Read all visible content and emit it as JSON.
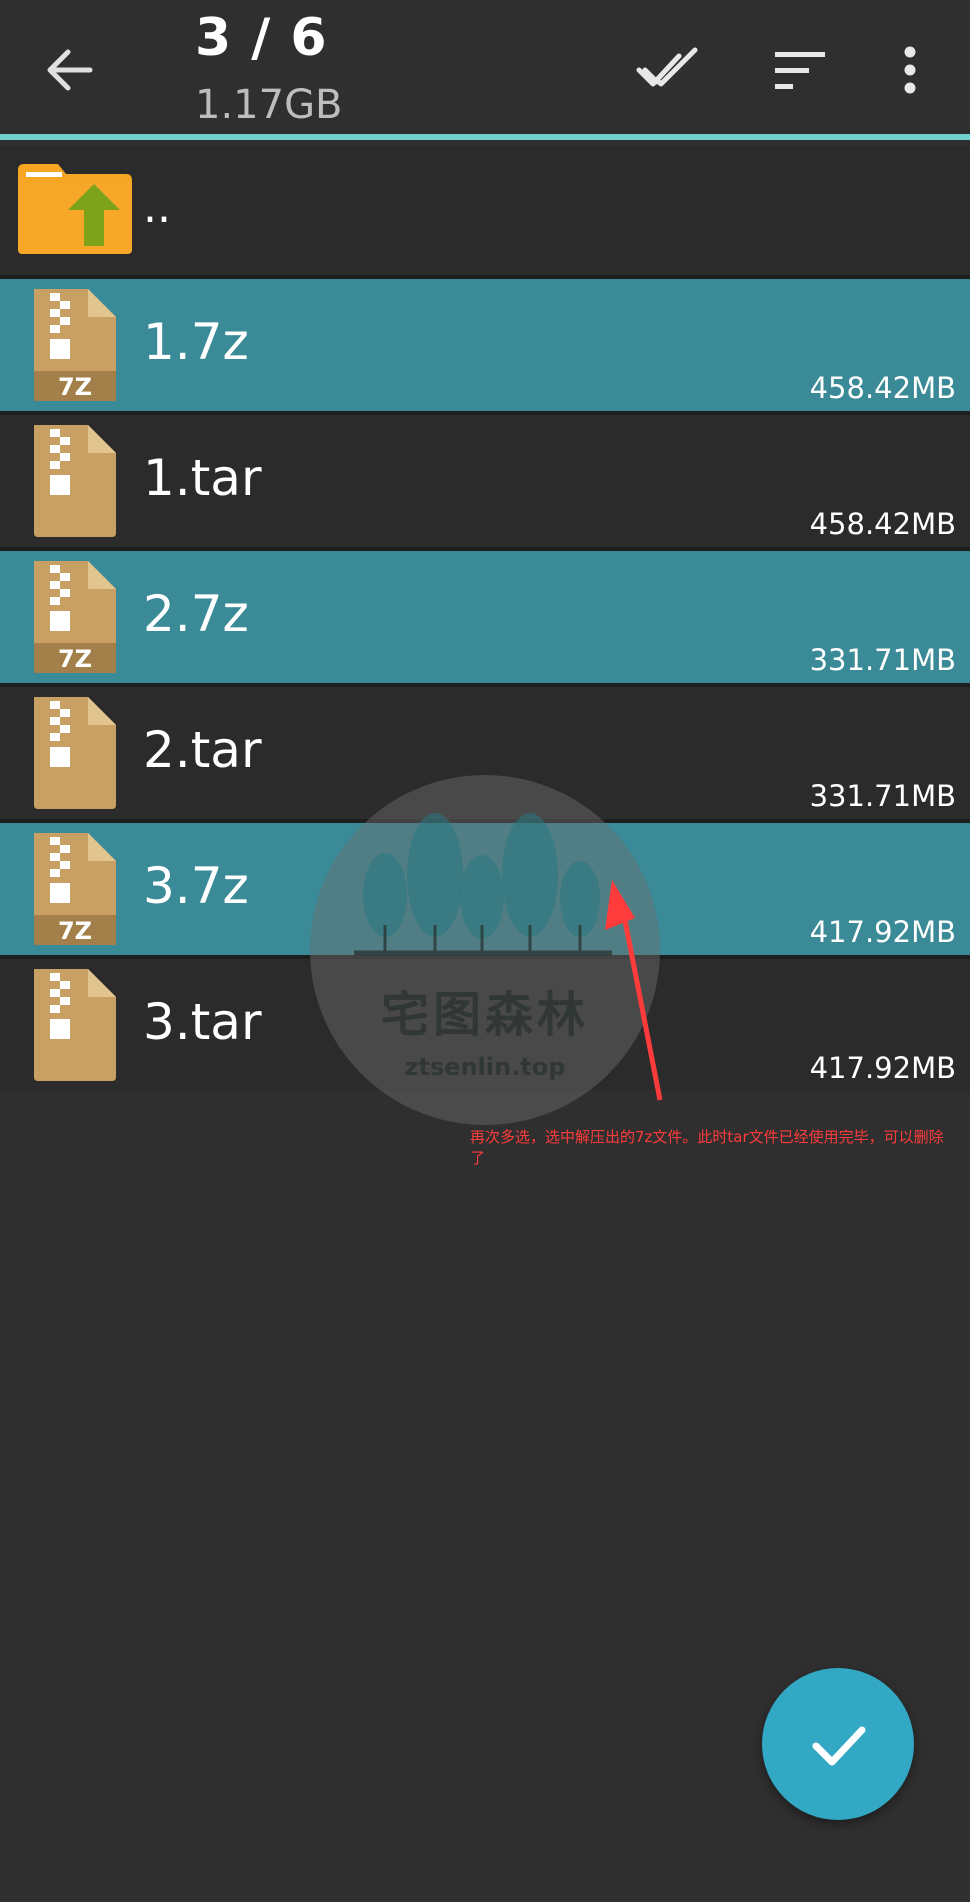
{
  "appbar": {
    "title": "3 / 6",
    "subtitle": "1.17GB",
    "back_icon": "arrow-back-icon",
    "select_all_icon": "double-check-icon",
    "sort_icon": "sort-icon",
    "menu_icon": "more-vert-icon"
  },
  "parent": {
    "name": "..",
    "icon": "folder-up-icon"
  },
  "files": [
    {
      "name": "1.7z",
      "size": "458.42MB",
      "type": "7z",
      "badge": "7Z",
      "selected": true
    },
    {
      "name": "1.tar",
      "size": "458.42MB",
      "type": "tar",
      "badge": "",
      "selected": false
    },
    {
      "name": "2.7z",
      "size": "331.71MB",
      "type": "7z",
      "badge": "7Z",
      "selected": true
    },
    {
      "name": "2.tar",
      "size": "331.71MB",
      "type": "tar",
      "badge": "",
      "selected": false
    },
    {
      "name": "3.7z",
      "size": "417.92MB",
      "type": "7z",
      "badge": "7Z",
      "selected": true
    },
    {
      "name": "3.tar",
      "size": "417.92MB",
      "type": "tar",
      "badge": "",
      "selected": false
    }
  ],
  "watermark": {
    "title": "宅图森林",
    "url": "ztsenlin.top"
  },
  "annotation": {
    "text": "再次多选，选中解压出的7z文件。此时tar文件已经使用完毕，可以删除了",
    "color": "#ff3b3b"
  },
  "fab": {
    "icon": "check-icon"
  },
  "colors": {
    "background": "#2f2f2f",
    "selected_row": "#3a8a97",
    "accent_line": "#6fd0cc",
    "fab": "#32a8c4",
    "archive_icon": "#c8a064"
  }
}
